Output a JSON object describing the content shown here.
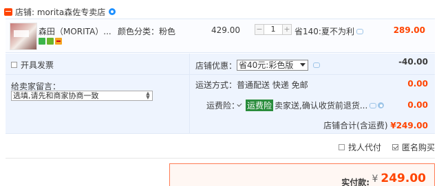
{
  "shop": {
    "name": "店铺: morita森佐专卖店"
  },
  "item": {
    "title": "森田（MORITA）...",
    "color_attr": "颜色分类：粉色",
    "unit_price": "429.00",
    "quantity": "1",
    "promo": "省140:夏不为利",
    "subtotal": "289.00"
  },
  "options": {
    "invoice_label": "开具发票",
    "message_label": "给卖家留言：",
    "message_value": "选填,请先和商家协商一致",
    "shop_discount_label": "店铺优惠：",
    "shop_discount_selected": "省40元:彩色版",
    "shop_discount_value": "-40.00",
    "shipping_label": "运送方式：",
    "shipping_value": "普通配送 快递 免邮",
    "shipping_fee": "0.00",
    "insurance_label": "运费险：",
    "insurance_tag": "运费险",
    "insurance_desc": "卖家送,确认收货前退货...",
    "insurance_fee": "0.00",
    "shop_total_label": "店铺合计(含运费)",
    "shop_total_amount": "¥249.00"
  },
  "checkout": {
    "proxy_pay_label": "找人代付",
    "anonymous_label": "匿名购买",
    "pay_label": "实付款:",
    "pay_currency": "¥",
    "pay_amount": "249.00"
  },
  "colors": {
    "accent": "#ff4400",
    "panel_bg": "#eef4fe",
    "insurance_tag": "#2a8c3c"
  }
}
